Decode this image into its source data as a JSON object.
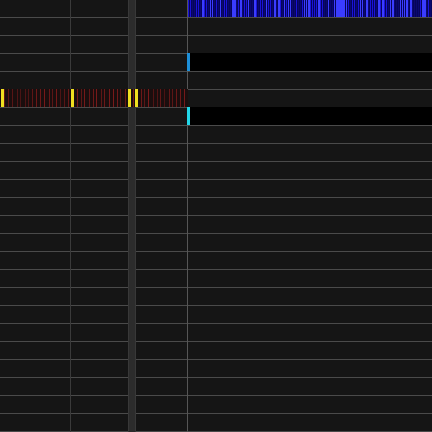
{
  "view": {
    "name": "track-timeline",
    "row_count": 24,
    "colors": {
      "background": "#141414",
      "row": "#151515",
      "divider": "#4a4a4a",
      "grid_line": "#3a3a3a",
      "waveform": "#1a12d8",
      "waveform_bright": "#3a3cff",
      "lane_band": "#000000",
      "marker_blue": "#1d8fd8",
      "marker_cyan": "#22d6e8",
      "event_marker": "#f0e020",
      "event_tick": "#7a1a1a"
    },
    "icons": [],
    "tracks": [
      {
        "id": "track-waveform",
        "kind": "audio-waveform",
        "marker": null
      },
      {
        "id": "track-lane-a",
        "kind": "lane",
        "marker": "marker_blue"
      },
      {
        "id": "track-events",
        "kind": "event-strip",
        "marker": null
      },
      {
        "id": "track-lane-b",
        "kind": "lane",
        "marker": "marker_cyan"
      }
    ]
  }
}
